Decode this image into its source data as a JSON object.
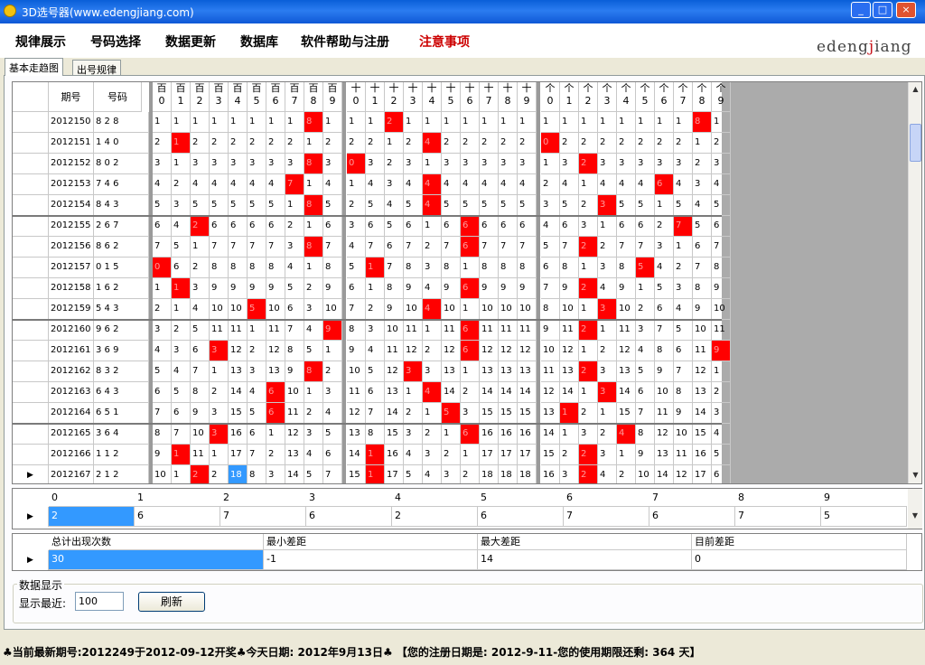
{
  "window": {
    "title": "3D选号器(www.edengjiang.com)",
    "min": "_",
    "max": "□",
    "close": "×"
  },
  "menu": [
    {
      "label": "规律展示",
      "color": "#000000"
    },
    {
      "label": "号码选择",
      "color": "#000000"
    },
    {
      "label": "数据更新",
      "color": "#000000"
    },
    {
      "label": "数据库",
      "color": "#000000"
    },
    {
      "label": "软件帮助与注册",
      "color": "#000000"
    },
    {
      "label": "注意事项",
      "color": "#cc0000"
    }
  ],
  "logo": {
    "pre": "edeng",
    "accent": "j",
    "post": "iang"
  },
  "tabs": [
    {
      "label": "基本走趋图"
    },
    {
      "label": "出号规律"
    }
  ],
  "colors": {
    "hit": "#ff0000",
    "selected": "#3399ff"
  },
  "grid": {
    "header": {
      "qi": "期号",
      "hm": "号码",
      "groups": [
        "百",
        "十",
        "个"
      ],
      "digits": [
        "0",
        "1",
        "2",
        "3",
        "4",
        "5",
        "6",
        "7",
        "8",
        "9"
      ]
    },
    "row_marker": "▶",
    "selected_row": 17,
    "selected_cell": 4,
    "rows": [
      {
        "qi": "2012150",
        "hm": "8 2 8",
        "cells": [
          "1",
          "1",
          "1",
          "1",
          "1",
          "1",
          "1",
          "1",
          "8",
          "1",
          "1",
          "1",
          "2",
          "1",
          "1",
          "1",
          "1",
          "1",
          "1",
          "1",
          "1",
          "1",
          "1",
          "1",
          "1",
          "1",
          "1",
          "1",
          "8",
          "1"
        ]
      },
      {
        "qi": "2012151",
        "hm": "1 4 0",
        "cells": [
          "2",
          "1",
          "2",
          "2",
          "2",
          "2",
          "2",
          "2",
          "1",
          "2",
          "2",
          "2",
          "1",
          "2",
          "4",
          "2",
          "2",
          "2",
          "2",
          "2",
          "0",
          "2",
          "2",
          "2",
          "2",
          "2",
          "2",
          "2",
          "1",
          "2"
        ]
      },
      {
        "qi": "2012152",
        "hm": "8 0 2",
        "cells": [
          "3",
          "1",
          "3",
          "3",
          "3",
          "3",
          "3",
          "3",
          "8",
          "3",
          "0",
          "3",
          "2",
          "3",
          "1",
          "3",
          "3",
          "3",
          "3",
          "3",
          "1",
          "3",
          "2",
          "3",
          "3",
          "3",
          "3",
          "3",
          "2",
          "3"
        ]
      },
      {
        "qi": "2012153",
        "hm": "7 4 6",
        "cells": [
          "4",
          "2",
          "4",
          "4",
          "4",
          "4",
          "4",
          "7",
          "1",
          "4",
          "1",
          "4",
          "3",
          "4",
          "4",
          "4",
          "4",
          "4",
          "4",
          "4",
          "2",
          "4",
          "1",
          "4",
          "4",
          "4",
          "6",
          "4",
          "3",
          "4"
        ]
      },
      {
        "qi": "2012154",
        "hm": "8 4 3",
        "cells": [
          "5",
          "3",
          "5",
          "5",
          "5",
          "5",
          "5",
          "1",
          "8",
          "5",
          "2",
          "5",
          "4",
          "5",
          "4",
          "5",
          "5",
          "5",
          "5",
          "5",
          "3",
          "5",
          "2",
          "3",
          "5",
          "5",
          "1",
          "5",
          "4",
          "5"
        ]
      },
      {
        "qi": "2012155",
        "hm": "2 6 7",
        "cells": [
          "6",
          "4",
          "2",
          "6",
          "6",
          "6",
          "6",
          "2",
          "1",
          "6",
          "3",
          "6",
          "5",
          "6",
          "1",
          "6",
          "6",
          "6",
          "6",
          "6",
          "4",
          "6",
          "3",
          "1",
          "6",
          "6",
          "2",
          "7",
          "5",
          "6"
        ]
      },
      {
        "qi": "2012156",
        "hm": "8 6 2",
        "cells": [
          "7",
          "5",
          "1",
          "7",
          "7",
          "7",
          "7",
          "3",
          "8",
          "7",
          "4",
          "7",
          "6",
          "7",
          "2",
          "7",
          "6",
          "7",
          "7",
          "7",
          "5",
          "7",
          "2",
          "2",
          "7",
          "7",
          "3",
          "1",
          "6",
          "7"
        ]
      },
      {
        "qi": "2012157",
        "hm": "0 1 5",
        "cells": [
          "0",
          "6",
          "2",
          "8",
          "8",
          "8",
          "8",
          "4",
          "1",
          "8",
          "5",
          "1",
          "7",
          "8",
          "3",
          "8",
          "1",
          "8",
          "8",
          "8",
          "6",
          "8",
          "1",
          "3",
          "8",
          "5",
          "4",
          "2",
          "7",
          "8"
        ]
      },
      {
        "qi": "2012158",
        "hm": "1 6 2",
        "cells": [
          "1",
          "1",
          "3",
          "9",
          "9",
          "9",
          "9",
          "5",
          "2",
          "9",
          "6",
          "1",
          "8",
          "9",
          "4",
          "9",
          "6",
          "9",
          "9",
          "9",
          "7",
          "9",
          "2",
          "4",
          "9",
          "1",
          "5",
          "3",
          "8",
          "9"
        ]
      },
      {
        "qi": "2012159",
        "hm": "5 4 3",
        "cells": [
          "2",
          "1",
          "4",
          "10",
          "10",
          "5",
          "10",
          "6",
          "3",
          "10",
          "7",
          "2",
          "9",
          "10",
          "4",
          "10",
          "1",
          "10",
          "10",
          "10",
          "8",
          "10",
          "1",
          "3",
          "10",
          "2",
          "6",
          "4",
          "9",
          "10"
        ]
      },
      {
        "qi": "2012160",
        "hm": "9 6 2",
        "cells": [
          "3",
          "2",
          "5",
          "11",
          "11",
          "1",
          "11",
          "7",
          "4",
          "9",
          "8",
          "3",
          "10",
          "11",
          "1",
          "11",
          "6",
          "11",
          "11",
          "11",
          "9",
          "11",
          "2",
          "1",
          "11",
          "3",
          "7",
          "5",
          "10",
          "11"
        ]
      },
      {
        "qi": "2012161",
        "hm": "3 6 9",
        "cells": [
          "4",
          "3",
          "6",
          "3",
          "12",
          "2",
          "12",
          "8",
          "5",
          "1",
          "9",
          "4",
          "11",
          "12",
          "2",
          "12",
          "6",
          "12",
          "12",
          "12",
          "10",
          "12",
          "1",
          "2",
          "12",
          "4",
          "8",
          "6",
          "11",
          "9"
        ]
      },
      {
        "qi": "2012162",
        "hm": "8 3 2",
        "cells": [
          "5",
          "4",
          "7",
          "1",
          "13",
          "3",
          "13",
          "9",
          "8",
          "2",
          "10",
          "5",
          "12",
          "3",
          "3",
          "13",
          "1",
          "13",
          "13",
          "13",
          "11",
          "13",
          "2",
          "3",
          "13",
          "5",
          "9",
          "7",
          "12",
          "1"
        ]
      },
      {
        "qi": "2012163",
        "hm": "6 4 3",
        "cells": [
          "6",
          "5",
          "8",
          "2",
          "14",
          "4",
          "6",
          "10",
          "1",
          "3",
          "11",
          "6",
          "13",
          "1",
          "4",
          "14",
          "2",
          "14",
          "14",
          "14",
          "12",
          "14",
          "1",
          "3",
          "14",
          "6",
          "10",
          "8",
          "13",
          "2"
        ]
      },
      {
        "qi": "2012164",
        "hm": "6 5 1",
        "cells": [
          "7",
          "6",
          "9",
          "3",
          "15",
          "5",
          "6",
          "11",
          "2",
          "4",
          "12",
          "7",
          "14",
          "2",
          "1",
          "5",
          "3",
          "15",
          "15",
          "15",
          "13",
          "1",
          "2",
          "1",
          "15",
          "7",
          "11",
          "9",
          "14",
          "3"
        ]
      },
      {
        "qi": "2012165",
        "hm": "3 6 4",
        "cells": [
          "8",
          "7",
          "10",
          "3",
          "16",
          "6",
          "1",
          "12",
          "3",
          "5",
          "13",
          "8",
          "15",
          "3",
          "2",
          "1",
          "6",
          "16",
          "16",
          "16",
          "14",
          "1",
          "3",
          "2",
          "4",
          "8",
          "12",
          "10",
          "15",
          "4"
        ]
      },
      {
        "qi": "2012166",
        "hm": "1 1 2",
        "cells": [
          "9",
          "1",
          "11",
          "1",
          "17",
          "7",
          "2",
          "13",
          "4",
          "6",
          "14",
          "1",
          "16",
          "4",
          "3",
          "2",
          "1",
          "17",
          "17",
          "17",
          "15",
          "2",
          "2",
          "3",
          "1",
          "9",
          "13",
          "11",
          "16",
          "5"
        ]
      },
      {
        "qi": "2012167",
        "hm": "2 1 2",
        "cells": [
          "10",
          "1",
          "2",
          "2",
          "18",
          "8",
          "3",
          "14",
          "5",
          "7",
          "15",
          "1",
          "17",
          "5",
          "4",
          "3",
          "2",
          "18",
          "18",
          "18",
          "16",
          "3",
          "2",
          "4",
          "2",
          "10",
          "14",
          "12",
          "17",
          "6"
        ]
      }
    ],
    "reds": [
      [
        8,
        12,
        28
      ],
      [
        1,
        14,
        20
      ],
      [
        8,
        10,
        22
      ],
      [
        7,
        14,
        26
      ],
      [
        8,
        14,
        23
      ],
      [
        2,
        16,
        27
      ],
      [
        8,
        16,
        22
      ],
      [
        0,
        11,
        25
      ],
      [
        1,
        16,
        22
      ],
      [
        5,
        14,
        23
      ],
      [
        9,
        16,
        22
      ],
      [
        3,
        16,
        29
      ],
      [
        8,
        13,
        22
      ],
      [
        6,
        14,
        23
      ],
      [
        6,
        15,
        21
      ],
      [
        3,
        16,
        24
      ],
      [
        1,
        11,
        22
      ],
      [
        2,
        11,
        22
      ]
    ]
  },
  "gap": {
    "marker": "▶",
    "headers": [
      "0",
      "1",
      "2",
      "3",
      "4",
      "5",
      "6",
      "7",
      "8",
      "9"
    ],
    "values": [
      "2",
      "6",
      "7",
      "6",
      "2",
      "6",
      "7",
      "6",
      "7",
      "5"
    ]
  },
  "stats": {
    "marker": "▶",
    "headers": [
      "总计出现次数",
      "最小差距",
      "最大差距",
      "目前差距"
    ],
    "values": [
      "30",
      "-1",
      "14",
      "0"
    ]
  },
  "display": {
    "group_label": "数据显示",
    "recent_label": "显示最近:",
    "recent_value": "100",
    "refresh": "刷新"
  },
  "status": "♣当前最新期号:2012249于2012-09-12开奖♣今天日期: 2012年9月13日♣  【您的注册日期是: 2012-9-11-您的使用期限还剩: 364 天】"
}
